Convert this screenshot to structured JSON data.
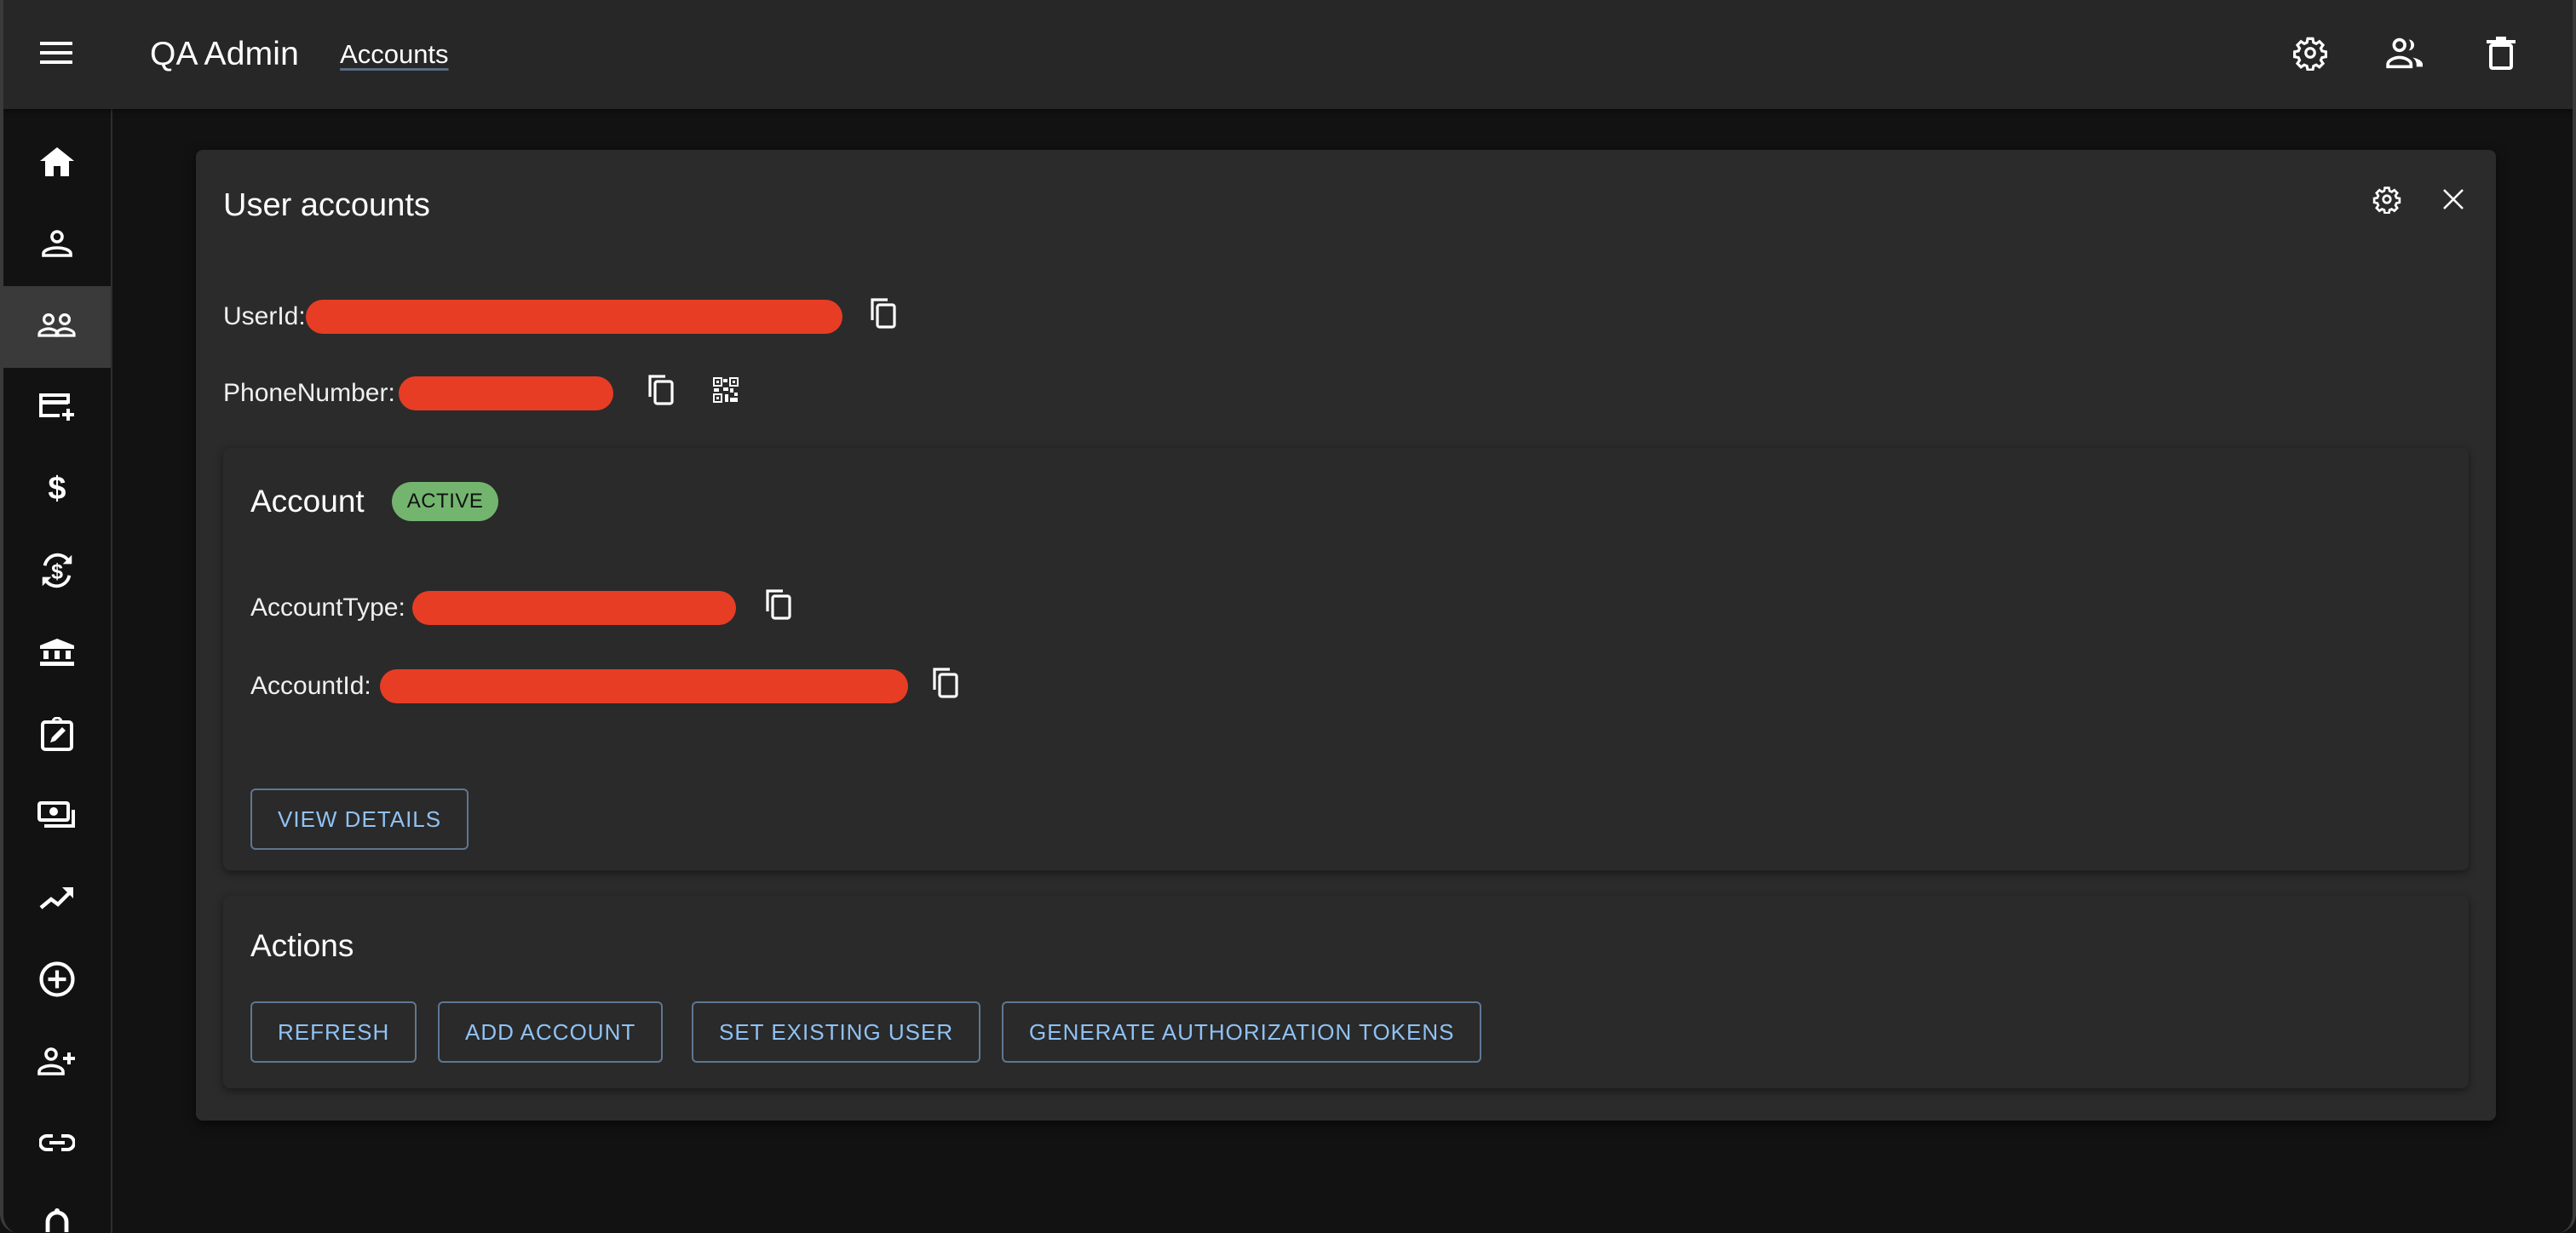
{
  "appbar": {
    "title": "QA Admin",
    "breadcrumb": "Accounts",
    "menu_icon": "hamburger-menu-icon",
    "actions": [
      {
        "icon": "settings-gear-icon"
      },
      {
        "icon": "people-icon"
      },
      {
        "icon": "trash-icon"
      }
    ]
  },
  "sidebar": {
    "items": [
      {
        "icon": "home-icon",
        "active": false
      },
      {
        "icon": "person-icon",
        "active": false
      },
      {
        "icon": "people-icon",
        "active": true
      },
      {
        "icon": "add-card-icon",
        "active": false
      },
      {
        "icon": "dollar-icon",
        "active": false
      },
      {
        "icon": "currency-exchange-icon",
        "active": false
      },
      {
        "icon": "bank-icon",
        "active": false
      },
      {
        "icon": "assignment-edit-icon",
        "active": false
      },
      {
        "icon": "payments-icon",
        "active": false
      },
      {
        "icon": "trending-up-icon",
        "active": false
      },
      {
        "icon": "add-circle-icon",
        "active": false
      },
      {
        "icon": "person-add-icon",
        "active": false
      },
      {
        "icon": "link-icon",
        "active": false
      },
      {
        "icon": "notification-bell-icon",
        "active": false
      }
    ]
  },
  "card": {
    "title": "User accounts",
    "fields": {
      "user_id_label": "UserId:",
      "user_id_value": "[redacted]",
      "phone_label": "PhoneNumber:",
      "phone_value": "[redacted]"
    }
  },
  "account": {
    "title": "Account",
    "status": "ACTIVE",
    "status_color": "#73b56f",
    "account_type_label": "AccountType:",
    "account_type_value": "[redacted]",
    "account_id_label": "AccountId:",
    "account_id_value": "[redacted]",
    "view_details_label": "VIEW DETAILS"
  },
  "actions": {
    "title": "Actions",
    "buttons": [
      {
        "label": "REFRESH"
      },
      {
        "label": "ADD ACCOUNT"
      },
      {
        "label": "SET EXISTING USER"
      },
      {
        "label": "GENERATE AUTHORIZATION TOKENS"
      }
    ]
  },
  "colors": {
    "appbar_bg": "#272727",
    "page_bg": "#121212",
    "card_bg": "#2b2b2b",
    "button_text": "#90c2f4",
    "button_border": "#5f7690",
    "redaction": "#e73d25"
  }
}
